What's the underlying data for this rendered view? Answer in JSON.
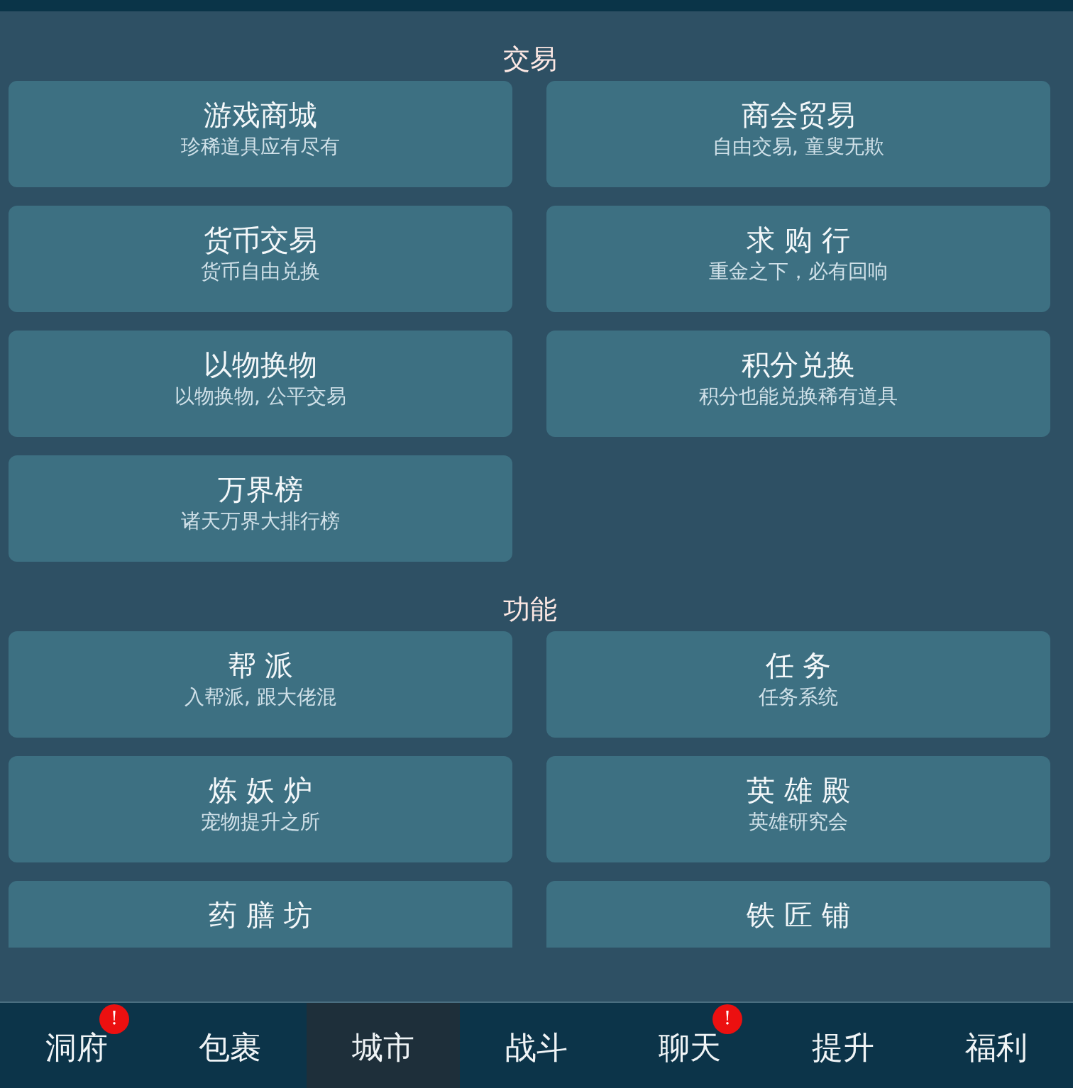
{
  "sections": [
    {
      "title": "交易",
      "items": [
        {
          "title": "游戏商城",
          "subtitle": "珍稀道具应有尽有"
        },
        {
          "title": "商会贸易",
          "subtitle": "自由交易, 童叟无欺"
        },
        {
          "title": "货币交易",
          "subtitle": "货币自由兑换"
        },
        {
          "title": "求 购 行",
          "subtitle": "重金之下，必有回响"
        },
        {
          "title": "以物换物",
          "subtitle": "以物换物, 公平交易"
        },
        {
          "title": "积分兑换",
          "subtitle": "积分也能兑换稀有道具"
        },
        {
          "title": "万界榜",
          "subtitle": "诸天万界大排行榜"
        }
      ]
    },
    {
      "title": "功能",
      "items": [
        {
          "title": "帮 派",
          "subtitle": "入帮派, 跟大佬混"
        },
        {
          "title": "任 务",
          "subtitle": "任务系统"
        },
        {
          "title": "炼 妖 炉",
          "subtitle": "宠物提升之所"
        },
        {
          "title": "英 雄 殿",
          "subtitle": "英雄研究会"
        },
        {
          "title": "药 膳 坊"
        },
        {
          "title": "铁 匠 铺"
        }
      ]
    }
  ],
  "nav": [
    {
      "label": "洞府",
      "selected": false,
      "badge": "!"
    },
    {
      "label": "包裹",
      "selected": false
    },
    {
      "label": "城市",
      "selected": true
    },
    {
      "label": "战斗",
      "selected": false
    },
    {
      "label": "聊天",
      "selected": false,
      "badge": "!"
    },
    {
      "label": "提升",
      "selected": false
    },
    {
      "label": "福利",
      "selected": false
    }
  ]
}
